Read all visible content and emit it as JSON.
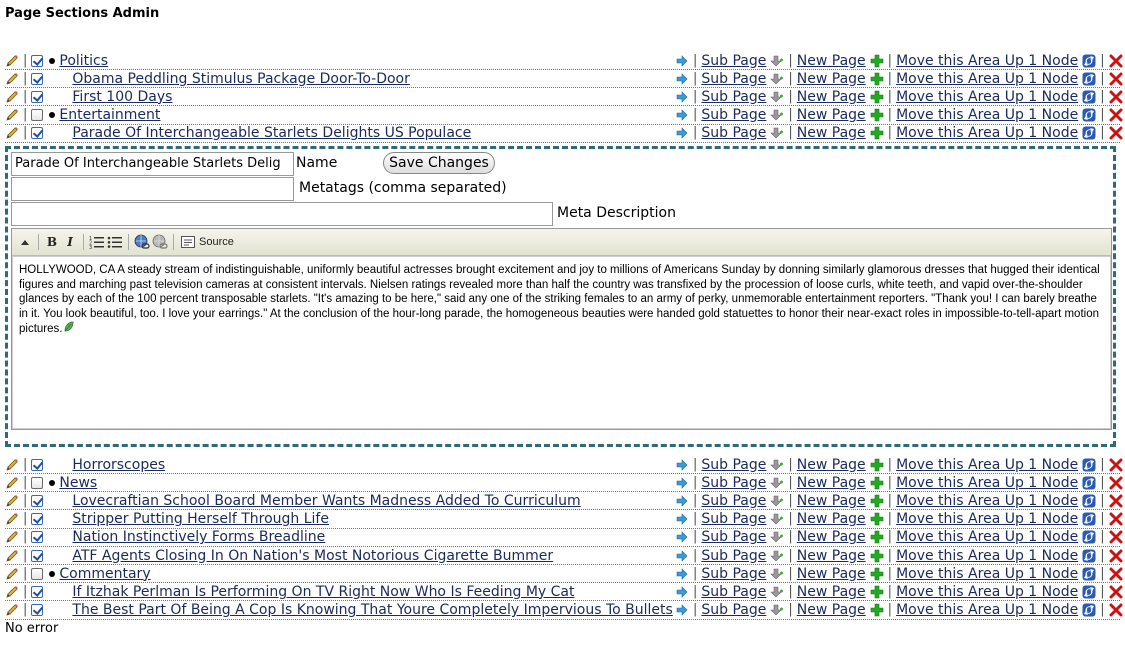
{
  "page": {
    "title": "Page Sections Admin",
    "status": "No error"
  },
  "actions": {
    "sub_page": "Sub Page",
    "new_page": "New Page",
    "move_up": "Move this Area Up 1 Node"
  },
  "rows_top": [
    {
      "title": "Politics",
      "checked": true,
      "level": 0
    },
    {
      "title": "Obama Peddling Stimulus Package Door-To-Door",
      "checked": true,
      "level": 1
    },
    {
      "title": "First 100 Days",
      "checked": true,
      "level": 1
    },
    {
      "title": "Entertainment",
      "checked": false,
      "level": 0
    },
    {
      "title": "Parade Of Interchangeable Starlets Delights US Populace",
      "checked": true,
      "level": 1
    }
  ],
  "rows_bottom": [
    {
      "title": "Horrorscopes",
      "checked": true,
      "level": 1
    },
    {
      "title": "News",
      "checked": false,
      "level": 0
    },
    {
      "title": "Lovecraftian School Board Member Wants Madness Added To Curriculum",
      "checked": true,
      "level": 1
    },
    {
      "title": "Stripper Putting Herself Through Life",
      "checked": true,
      "level": 1
    },
    {
      "title": "Nation Instinctively Forms Breadline",
      "checked": true,
      "level": 1
    },
    {
      "title": "ATF Agents Closing In On Nation's Most Notorious Cigarette Bummer",
      "checked": true,
      "level": 1
    },
    {
      "title": "Commentary",
      "checked": false,
      "level": 0
    },
    {
      "title": "If Itzhak Perlman Is Performing On TV Right Now Who Is Feeding My Cat",
      "checked": true,
      "level": 1
    },
    {
      "title": "The Best Part Of Being A Cop Is Knowing That Youre Completely Impervious To Bullets",
      "checked": true,
      "level": 1
    }
  ],
  "editor": {
    "name_value": "Parade Of Interchangeable Starlets Delig",
    "name_label": "Name",
    "save_label": "Save Changes",
    "metatags_value": "",
    "metatags_label": "Metatags (comma separated)",
    "meta_desc_value": "",
    "meta_desc_label": "Meta Description",
    "toolbar": {
      "bold": "B",
      "italic": "I",
      "source": "Source"
    },
    "body": "HOLLYWOOD, CA A steady stream of indistinguishable, uniformly beautiful actresses brought excitement and joy to millions of Americans Sunday by donning similarly glamorous dresses that hugged their identical figures and marching past television cameras at consistent intervals. Nielsen ratings revealed more than half the country was transfixed by the procession of loose curls, white teeth, and vapid over-the-shoulder glances by each of the 100 percent transposable starlets. \"It's amazing to be here,\" said any one of the striking females to an army of perky, unmemorable entertainment reporters. \"Thank you! I can barely breathe in it. You look beautiful, too. I love your earrings.\" At the conclusion of the hour-long parade, the homogeneous beauties were handed gold statuettes to honor their near-exact roles in impossible-to-tell-apart motion pictures."
  },
  "colors": {
    "link": "#1b2a5c",
    "editor_border": "#2e6b75",
    "delete": "#cc1111",
    "add": "#22aa22"
  }
}
